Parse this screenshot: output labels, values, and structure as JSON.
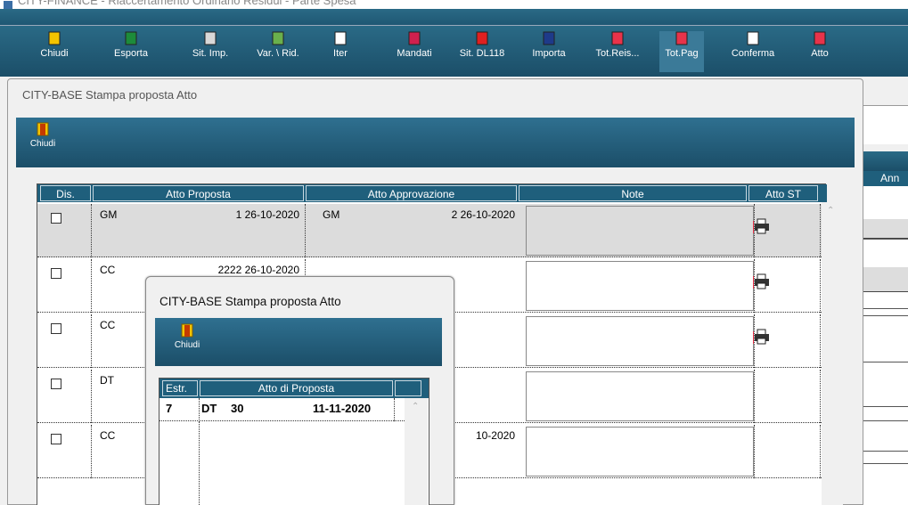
{
  "main_window": {
    "title_fragment": "CITY-FINANCE - Riaccertamento Ordinario Residui - Parte Spesa",
    "toolbar": [
      {
        "label": "Chiudi",
        "icon": "door-exit-icon",
        "color": "#f4c400"
      },
      {
        "label": "Esporta",
        "icon": "excel-export-icon",
        "color": "#1d8b3a"
      },
      {
        "label": "Sit. Imp.",
        "icon": "book-icon",
        "color": "#d8d8d8"
      },
      {
        "label": "Var. \\ Rid.",
        "icon": "variation-icon",
        "color": "#6ab04c"
      },
      {
        "label": "Iter",
        "icon": "card-icon",
        "color": "#ffffff"
      },
      {
        "label": "Mandati",
        "icon": "mandate-icon",
        "color": "#d0204e"
      },
      {
        "label": "Sit. DL118",
        "icon": "dl118-icon",
        "color": "#e02020"
      },
      {
        "label": "Importa",
        "icon": "import-icon",
        "color": "#1e3a8a"
      },
      {
        "label": "Tot.Reis...",
        "icon": "totals-reis-icon",
        "color": "#e8334a"
      },
      {
        "label": "Tot.Pag",
        "icon": "sum-icon",
        "color": "#e8334a"
      },
      {
        "label": "Conferma",
        "icon": "signature-icon",
        "color": "#ffffff"
      },
      {
        "label": "Atto",
        "icon": "document-icon",
        "color": "#e8334a"
      }
    ],
    "right_header_partial": "Ann"
  },
  "dialog_main": {
    "title": "CITY-BASE Stampa proposta Atto",
    "close_label": "Chiudi",
    "columns": [
      "Dis.",
      "Atto Proposta",
      "Atto Approvazione",
      "Note",
      "Atto ST"
    ],
    "rows": [
      {
        "type": "GM",
        "proposal": "1 26-10-2020",
        "appr_type": "GM",
        "approval": "2 26-10-2020",
        "printer": true,
        "selected": true
      },
      {
        "type": "CC",
        "proposal": "2222 26-10-2020",
        "appr_type": "",
        "approval": "",
        "printer": true,
        "selected": false
      },
      {
        "type": "CC",
        "proposal": "",
        "appr_type": "",
        "approval": "",
        "printer": true,
        "selected": false
      },
      {
        "type": "DT",
        "proposal": "",
        "appr_type": "",
        "approval": "",
        "printer": false,
        "selected": false
      },
      {
        "type": "CC",
        "proposal": "",
        "appr_type": "",
        "approval": "10-2020",
        "printer": false,
        "selected": false
      }
    ]
  },
  "dialog_inner": {
    "title": "CITY-BASE Stampa proposta Atto",
    "close_label": "Chiudi",
    "columns": [
      "Estr.",
      "Atto di Proposta"
    ],
    "row": {
      "estr": "7",
      "type": "DT",
      "number": "30",
      "date": "11-11-2020"
    }
  },
  "colors": {
    "toolbar_bg": "#1b4e68",
    "header_bg": "#1f5f7c",
    "selected_row": "#dcdcdc"
  }
}
